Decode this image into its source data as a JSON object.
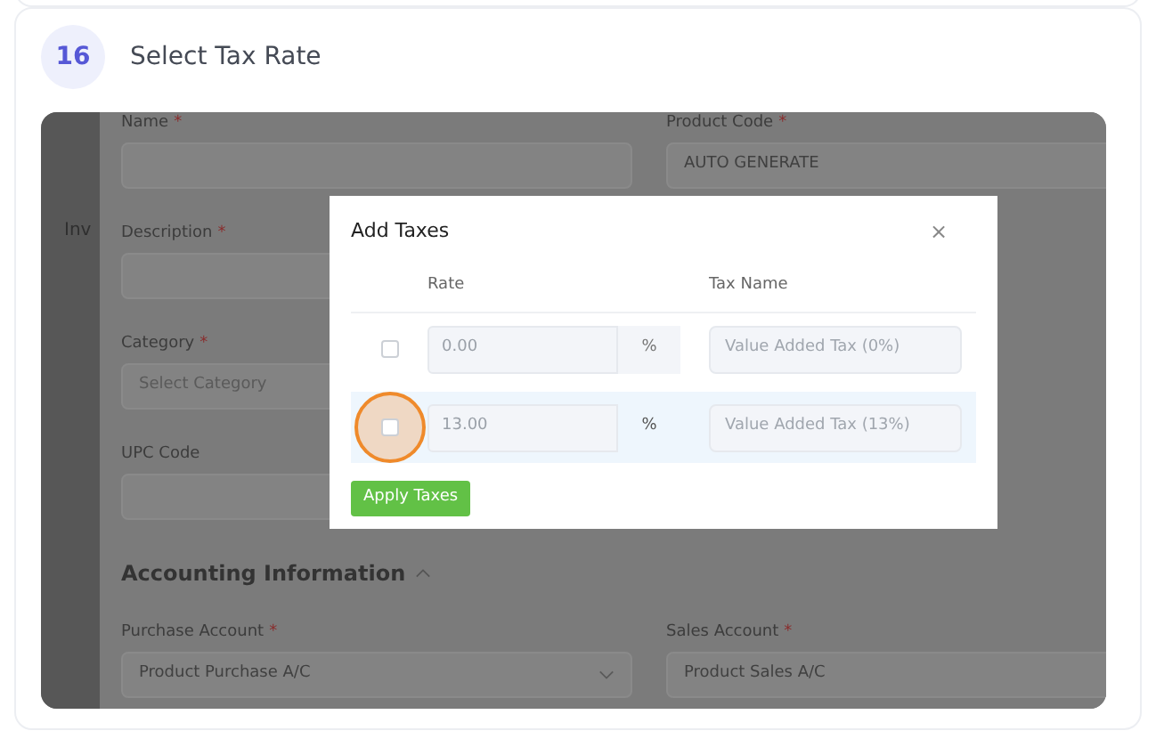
{
  "step": {
    "number": "16",
    "title": "Select Tax Rate"
  },
  "background_app": {
    "sidebar_text": "Inv",
    "rows": [
      {
        "kind": "fields",
        "fields": [
          {
            "label": "Name",
            "required_mark": "*"
          },
          {
            "label": "Product Code",
            "required_mark": "*",
            "value": "AUTO GENERATE"
          }
        ]
      },
      {
        "kind": "fields",
        "fields": [
          {
            "label": "Description",
            "required_mark": "*"
          }
        ]
      },
      {
        "kind": "fields",
        "fields": [
          {
            "label": "Category",
            "required_mark": "*",
            "placeholder": "Select Category"
          }
        ]
      },
      {
        "kind": "fields",
        "fields": [
          {
            "label": "UPC Code"
          }
        ]
      },
      {
        "kind": "heading",
        "text": "Accounting Information",
        "expanded": true
      },
      {
        "kind": "fields",
        "fields": [
          {
            "label": "Purchase Account",
            "required_mark": "*",
            "value": "Product Purchase A/C",
            "dropdown": true
          },
          {
            "label": "Sales Account",
            "required_mark": "*",
            "value": "Product Sales A/C"
          }
        ]
      }
    ]
  },
  "modal": {
    "title": "Add Taxes",
    "close": "×",
    "columns": [
      "Rate",
      "Tax Name"
    ],
    "rows": [
      {
        "checked": false,
        "selected": false,
        "highlighted": false,
        "rate": "0.00",
        "unit": "%",
        "tax_name": "Value Added Tax (0%)"
      },
      {
        "checked": false,
        "selected": true,
        "highlighted": true,
        "rate": "13.00",
        "unit": "%",
        "tax_name": "Value Added Tax (13%)"
      }
    ],
    "button": "Apply Taxes"
  }
}
